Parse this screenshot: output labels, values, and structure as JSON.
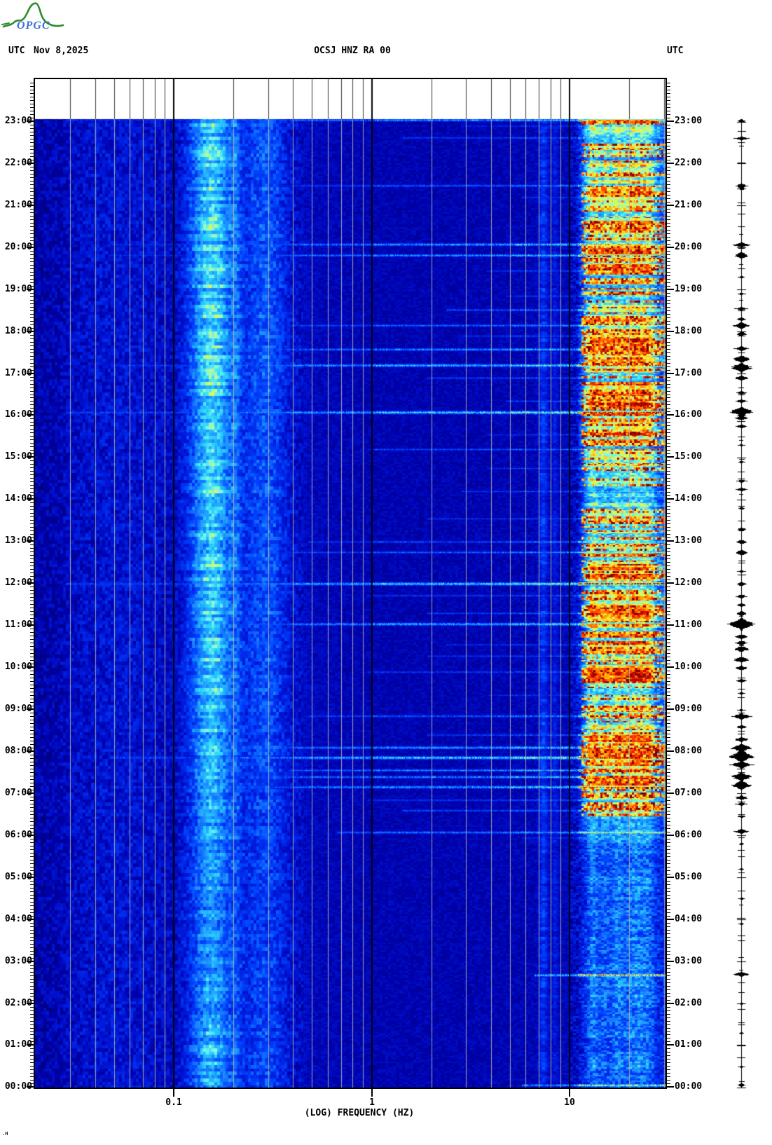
{
  "header": {
    "utc_left": "UTC",
    "date": "Nov 8,2025",
    "station": "OCSJ HNZ RA 00",
    "utc_right": "UTC"
  },
  "logo": {
    "org": "OPGC",
    "mountain_color": "#2e8b2e",
    "text_color": "#3b6fd6"
  },
  "corner_mark": ".H",
  "axes": {
    "x_label": "(LOG) FREQUENCY (HZ)",
    "x_major_ticks": [
      {
        "hz": 0.1,
        "label": "0.1"
      },
      {
        "hz": 1,
        "label": "1"
      },
      {
        "hz": 10,
        "label": "10"
      }
    ],
    "minor_gridlines_hz": [
      0.03,
      0.04,
      0.05,
      0.06,
      0.07,
      0.08,
      0.09,
      0.2,
      0.3,
      0.4,
      0.5,
      0.6,
      0.7,
      0.8,
      0.9,
      2,
      3,
      4,
      5,
      6,
      7,
      8,
      9,
      20,
      30
    ],
    "major_gridlines_hz": [
      0.1,
      1,
      10
    ],
    "hour_labels_top_to_bottom": [
      "23:00",
      "22:00",
      "21:00",
      "20:00",
      "19:00",
      "18:00",
      "17:00",
      "16:00",
      "15:00",
      "14:00",
      "13:00",
      "12:00",
      "11:00",
      "10:00",
      "09:00",
      "08:00",
      "07:00",
      "06:00",
      "05:00",
      "04:00",
      "03:00",
      "02:00",
      "01:00",
      "00:00"
    ]
  },
  "chart_data": {
    "type": "heatmap",
    "subtype": "seismic-spectrogram",
    "title": "OCSJ HNZ RA 00",
    "date_utc": "Nov 8,2025",
    "xlabel": "(LOG) FREQUENCY (HZ)",
    "x_scale": "log10",
    "freq_range_hz": [
      0.02,
      30
    ],
    "time_axis": "hours UTC, 00:00 bottom to 23:00 top, 5-min rows",
    "time_range_hours": [
      0,
      23.06
    ],
    "legend_position": "none",
    "grid": true,
    "seed": 42,
    "colormap_stops": [
      [
        0.0,
        0,
        0,
        110
      ],
      [
        0.1,
        0,
        0,
        170
      ],
      [
        0.2,
        0,
        25,
        220
      ],
      [
        0.3,
        0,
        70,
        255
      ],
      [
        0.4,
        30,
        140,
        255
      ],
      [
        0.5,
        40,
        210,
        255
      ],
      [
        0.57,
        120,
        245,
        235
      ],
      [
        0.65,
        200,
        255,
        120
      ],
      [
        0.72,
        255,
        235,
        40
      ],
      [
        0.79,
        255,
        150,
        0
      ],
      [
        0.86,
        255,
        60,
        0
      ],
      [
        0.92,
        205,
        10,
        0
      ],
      [
        1.0,
        125,
        0,
        0
      ]
    ],
    "base_spectrum": [
      [
        0.02,
        0.1
      ],
      [
        0.026,
        0.12
      ],
      [
        0.03,
        0.15
      ],
      [
        0.04,
        0.17
      ],
      [
        0.055,
        0.18
      ],
      [
        0.07,
        0.17
      ],
      [
        0.085,
        0.15
      ],
      [
        0.1,
        0.14
      ],
      [
        0.12,
        0.17
      ],
      [
        0.15,
        0.19
      ],
      [
        0.2,
        0.18
      ],
      [
        0.25,
        0.22
      ],
      [
        0.3,
        0.2
      ],
      [
        0.4,
        0.16
      ],
      [
        0.55,
        0.13
      ],
      [
        0.8,
        0.12
      ],
      [
        1.5,
        0.115
      ],
      [
        3,
        0.115
      ],
      [
        5,
        0.12
      ],
      [
        6.5,
        0.125
      ],
      [
        9,
        0.13
      ],
      [
        10.5,
        0.14
      ],
      [
        12,
        0.16
      ],
      [
        20,
        0.155
      ],
      [
        30,
        0.15
      ]
    ],
    "microseism_band": {
      "center_hz": 0.155,
      "sigma_log": 0.105,
      "peak_amp": 0.34,
      "secondary_hz": 0.205,
      "secondary_amp": 0.1,
      "tertiary_hz": 0.3,
      "tertiary_amp": 0.12
    },
    "microseism_gain_by_hour": [
      [
        0,
        0.85
      ],
      [
        1.5,
        0.8
      ],
      [
        3,
        0.7
      ],
      [
        4.5,
        0.65
      ],
      [
        6,
        0.75
      ],
      [
        8,
        0.9
      ],
      [
        10,
        1.0
      ],
      [
        13,
        1.0
      ],
      [
        16,
        1.05
      ],
      [
        18,
        1.1
      ],
      [
        20,
        1.05
      ],
      [
        22,
        1.0
      ],
      [
        23.1,
        1.0
      ]
    ],
    "hf_band_hz": [
      10.6,
      30
    ],
    "hf_activity_by_hour": [
      [
        0,
        0.12
      ],
      [
        0.5,
        0.14
      ],
      [
        1,
        0.12
      ],
      [
        2,
        0.12
      ],
      [
        2.6,
        0.2
      ],
      [
        3,
        0.12
      ],
      [
        4,
        0.1
      ],
      [
        5,
        0.11
      ],
      [
        5.8,
        0.15
      ],
      [
        6.2,
        0.45
      ],
      [
        6.8,
        0.8
      ],
      [
        7.3,
        1.0
      ],
      [
        8.2,
        1.0
      ],
      [
        8.8,
        0.8
      ],
      [
        9.3,
        0.75
      ],
      [
        9.8,
        0.9
      ],
      [
        10.5,
        0.95
      ],
      [
        11.1,
        1.0
      ],
      [
        11.8,
        0.85
      ],
      [
        12.3,
        0.9
      ],
      [
        13,
        0.8
      ],
      [
        13.6,
        0.6
      ],
      [
        14.3,
        0.65
      ],
      [
        15,
        0.6
      ],
      [
        15.6,
        0.75
      ],
      [
        16.2,
        0.9
      ],
      [
        16.8,
        0.8
      ],
      [
        17.3,
        1.0
      ],
      [
        18,
        0.95
      ],
      [
        18.7,
        0.75
      ],
      [
        19.3,
        0.7
      ],
      [
        19.9,
        0.9
      ],
      [
        20.5,
        0.75
      ],
      [
        21.1,
        0.85
      ],
      [
        21.7,
        0.7
      ],
      [
        22.2,
        0.5
      ],
      [
        22.7,
        0.65
      ],
      [
        23.06,
        0.8
      ]
    ],
    "vertical_stripes_hz": [
      {
        "hz": 7.35,
        "gain": 0.15,
        "sigma": 0.022
      },
      {
        "hz": 8.4,
        "gain": 0.08,
        "sigma": 0.015
      },
      {
        "hz": 13.2,
        "gain": 0.1,
        "sigma": 0.022
      },
      {
        "hz": 15.0,
        "gain": 0.05,
        "sigma": 0.02
      },
      {
        "hz": 17.5,
        "gain": 0.09,
        "sigma": 0.03
      },
      {
        "hz": 21.5,
        "gain": 0.11,
        "sigma": 0.05
      },
      {
        "hz": 25.0,
        "gain": 0.07,
        "sigma": 0.03
      }
    ],
    "events_t_gain_fmin_halfpx": [
      [
        23.04,
        0.8,
        0.03,
        2
      ],
      [
        22.9,
        0.45,
        3,
        1.5
      ],
      [
        22.62,
        0.55,
        1.5,
        1.5
      ],
      [
        21.48,
        0.65,
        0.1,
        1.8
      ],
      [
        21.2,
        0.45,
        6,
        1.5
      ],
      [
        20.08,
        0.85,
        0.05,
        2
      ],
      [
        19.82,
        0.8,
        0.05,
        2
      ],
      [
        19.45,
        0.5,
        4,
        1.5
      ],
      [
        18.85,
        0.45,
        5,
        1.5
      ],
      [
        18.52,
        0.6,
        2.5,
        1.8
      ],
      [
        18.15,
        0.65,
        0.4,
        2
      ],
      [
        17.9,
        0.5,
        3,
        1.5
      ],
      [
        17.58,
        0.8,
        0.1,
        2
      ],
      [
        17.2,
        0.9,
        0.05,
        2.5
      ],
      [
        16.9,
        0.55,
        2,
        1.5
      ],
      [
        16.35,
        0.5,
        5,
        1.5
      ],
      [
        16.08,
        1.0,
        0.03,
        2.5
      ],
      [
        15.55,
        0.45,
        4,
        1.3
      ],
      [
        15.2,
        0.55,
        1,
        1.6
      ],
      [
        14.75,
        0.45,
        4,
        1.4
      ],
      [
        14.2,
        0.5,
        3,
        1.4
      ],
      [
        13.55,
        0.5,
        2,
        1.4
      ],
      [
        13.0,
        0.6,
        0.5,
        1.7
      ],
      [
        12.75,
        0.65,
        0.3,
        1.8
      ],
      [
        12.0,
        1.0,
        0.03,
        2.5
      ],
      [
        11.72,
        0.55,
        1,
        1.4
      ],
      [
        11.3,
        0.55,
        2,
        1.4
      ],
      [
        11.04,
        0.9,
        0.25,
        2.2
      ],
      [
        10.55,
        0.5,
        2.5,
        1.4
      ],
      [
        10.28,
        0.5,
        2,
        1.4
      ],
      [
        9.9,
        0.55,
        1,
        1.5
      ],
      [
        9.35,
        0.45,
        4,
        1.3
      ],
      [
        8.85,
        0.65,
        0.5,
        1.8
      ],
      [
        8.4,
        0.55,
        2,
        1.5
      ],
      [
        8.1,
        0.85,
        0.1,
        2.2
      ],
      [
        7.86,
        1.0,
        0.05,
        2.6
      ],
      [
        7.56,
        0.75,
        0.4,
        2
      ],
      [
        7.4,
        0.8,
        0.25,
        2
      ],
      [
        7.16,
        0.85,
        0.05,
        2.3
      ],
      [
        6.85,
        0.55,
        1,
        1.5
      ],
      [
        6.6,
        0.6,
        1.5,
        1.6
      ],
      [
        6.08,
        0.75,
        0.7,
        1.9
      ],
      [
        5.95,
        0.45,
        6,
        1.3
      ],
      [
        2.68,
        0.85,
        7,
        1.9
      ],
      [
        0.06,
        0.7,
        6,
        1.8
      ]
    ],
    "trace_spikes_t_amp_width": [
      [
        23.02,
        5,
        1.5
      ],
      [
        22.6,
        9,
        1.5
      ],
      [
        21.48,
        8,
        2
      ],
      [
        21.4,
        6,
        1
      ],
      [
        20.08,
        11,
        2
      ],
      [
        19.82,
        9,
        3
      ],
      [
        19.3,
        4,
        1
      ],
      [
        18.9,
        5,
        1
      ],
      [
        18.55,
        8,
        1.5
      ],
      [
        18.3,
        6,
        1.5
      ],
      [
        18.15,
        10,
        3
      ],
      [
        17.95,
        7,
        2
      ],
      [
        17.6,
        9,
        2
      ],
      [
        17.35,
        12,
        3
      ],
      [
        17.15,
        14,
        4
      ],
      [
        16.9,
        10,
        2
      ],
      [
        16.55,
        6,
        1.5
      ],
      [
        16.35,
        7,
        1.5
      ],
      [
        16.1,
        15,
        4
      ],
      [
        15.95,
        8,
        2
      ],
      [
        15.75,
        7,
        1.5
      ],
      [
        15.3,
        4,
        1
      ],
      [
        14.9,
        4,
        1
      ],
      [
        14.45,
        6,
        1.5
      ],
      [
        14.25,
        7,
        1.5
      ],
      [
        13.8,
        5,
        1
      ],
      [
        13.3,
        6,
        1.5
      ],
      [
        13.0,
        7,
        2
      ],
      [
        12.75,
        8,
        2.5
      ],
      [
        12.3,
        5,
        1
      ],
      [
        12.0,
        6,
        2
      ],
      [
        11.7,
        7,
        1.5
      ],
      [
        11.5,
        6,
        1.5
      ],
      [
        11.3,
        8,
        2
      ],
      [
        11.05,
        18,
        5
      ],
      [
        10.75,
        9,
        2
      ],
      [
        10.6,
        8,
        2
      ],
      [
        10.45,
        9,
        2.5
      ],
      [
        10.2,
        10,
        2.5
      ],
      [
        10.0,
        8,
        2
      ],
      [
        9.7,
        6,
        1.5
      ],
      [
        9.4,
        5,
        1
      ],
      [
        9.0,
        4,
        1
      ],
      [
        8.85,
        12,
        2.5
      ],
      [
        8.6,
        7,
        1.5
      ],
      [
        8.3,
        9,
        2
      ],
      [
        8.1,
        13,
        3.5
      ],
      [
        7.9,
        16,
        5
      ],
      [
        7.7,
        14,
        3
      ],
      [
        7.4,
        13,
        3.5
      ],
      [
        7.2,
        12,
        4
      ],
      [
        6.9,
        8,
        2
      ],
      [
        6.75,
        7,
        1.5
      ],
      [
        6.45,
        5,
        1
      ],
      [
        6.1,
        9,
        2
      ],
      [
        5.8,
        4,
        1
      ],
      [
        5.2,
        3,
        1
      ],
      [
        4.5,
        3,
        1
      ],
      [
        3.9,
        3,
        1
      ],
      [
        2.7,
        11,
        2
      ],
      [
        2.0,
        3,
        1
      ],
      [
        1.3,
        3,
        1
      ],
      [
        0.5,
        3,
        1
      ],
      [
        0.07,
        6,
        1.5
      ]
    ]
  }
}
